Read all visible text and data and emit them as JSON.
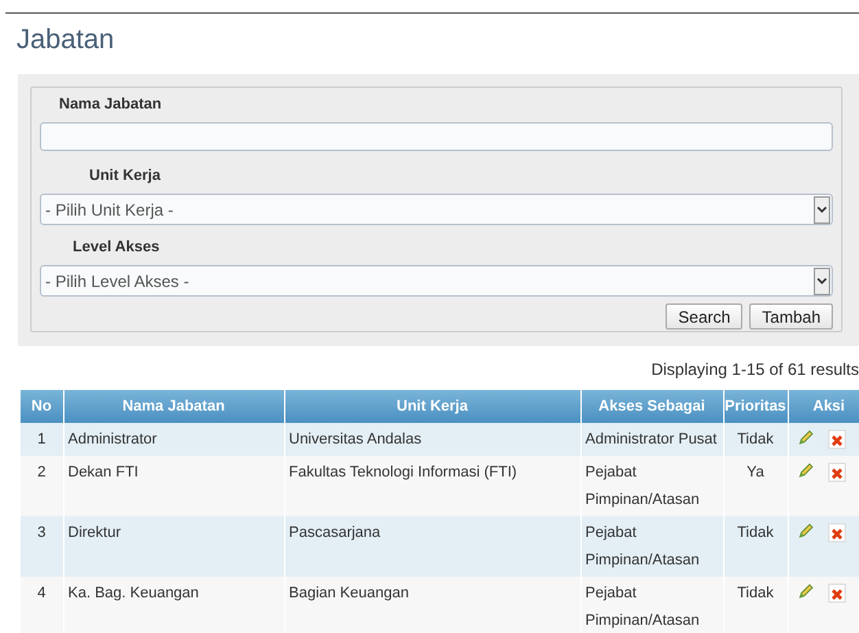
{
  "title": "Jabatan",
  "filter": {
    "fields": [
      {
        "kind": "text",
        "label": "Nama Jabatan"
      },
      {
        "kind": "select",
        "label": "Unit Kerja",
        "value": "- Pilih Unit Kerja -"
      },
      {
        "kind": "select",
        "label": "Level Akses",
        "value": "- Pilih Level Akses -"
      }
    ],
    "buttons": [
      "Search",
      "Tambah"
    ]
  },
  "summary": "Displaying 1-15 of 61 results",
  "table": {
    "columns": [
      "No",
      "Nama Jabatan",
      "Unit Kerja",
      "Akses Sebagai",
      "Prioritas",
      "Aksi"
    ],
    "rows": [
      {
        "no": "1",
        "nama": "Administrator",
        "unit": "Universitas Andalas",
        "akses": "Administrator Pusat",
        "prioritas": "Tidak"
      },
      {
        "no": "2",
        "nama": "Dekan FTI",
        "unit": "Fakultas Teknologi Informasi (FTI)",
        "akses": "Pejabat Pimpinan/Atasan",
        "prioritas": "Ya"
      },
      {
        "no": "3",
        "nama": "Direktur",
        "unit": "Pascasarjana",
        "akses": "Pejabat Pimpinan/Atasan",
        "prioritas": "Tidak"
      },
      {
        "no": "4",
        "nama": "Ka. Bag. Keuangan",
        "unit": "Bagian Keuangan",
        "akses": "Pejabat Pimpinan/Atasan",
        "prioritas": "Tidak"
      }
    ]
  }
}
